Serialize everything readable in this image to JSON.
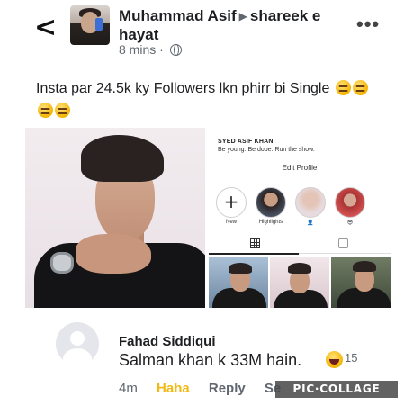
{
  "header": {
    "back_glyph": "<",
    "author": "Muhammad Asif",
    "target_group": "shareek e hayat",
    "time": "8 mins",
    "separator": "·",
    "more_glyph": "•••",
    "privacy_icon": "globe-icon"
  },
  "post": {
    "text": "Insta par 24.5k ky Followers lkn phirr bi Single",
    "emojis": [
      "unamused-emoji",
      "unamused-emoji",
      "unamused-emoji",
      "unamused-emoji"
    ]
  },
  "profile_screenshot": {
    "name": "SYED ASIF KHAN",
    "bio": "Be young. Be dope. Run the show.",
    "edit_profile_label": "Edit Profile",
    "highlights": [
      {
        "label": "New"
      },
      {
        "label": "Highlights"
      },
      {
        "label": "👤"
      },
      {
        "label": "😎"
      }
    ],
    "new_glyph": "+"
  },
  "comment": {
    "author": "Fahad Siddiqui",
    "text": "Salman khan k 33M hain.",
    "reaction_count": "15",
    "time": "4m",
    "haha_label": "Haha",
    "reply_label": "Reply",
    "see_label": "Se"
  },
  "watermark": "PIC·COLLAGE",
  "colors": {
    "text_primary": "#1c1e21",
    "text_secondary": "#606770",
    "haha_yellow": "#f0ba15"
  }
}
